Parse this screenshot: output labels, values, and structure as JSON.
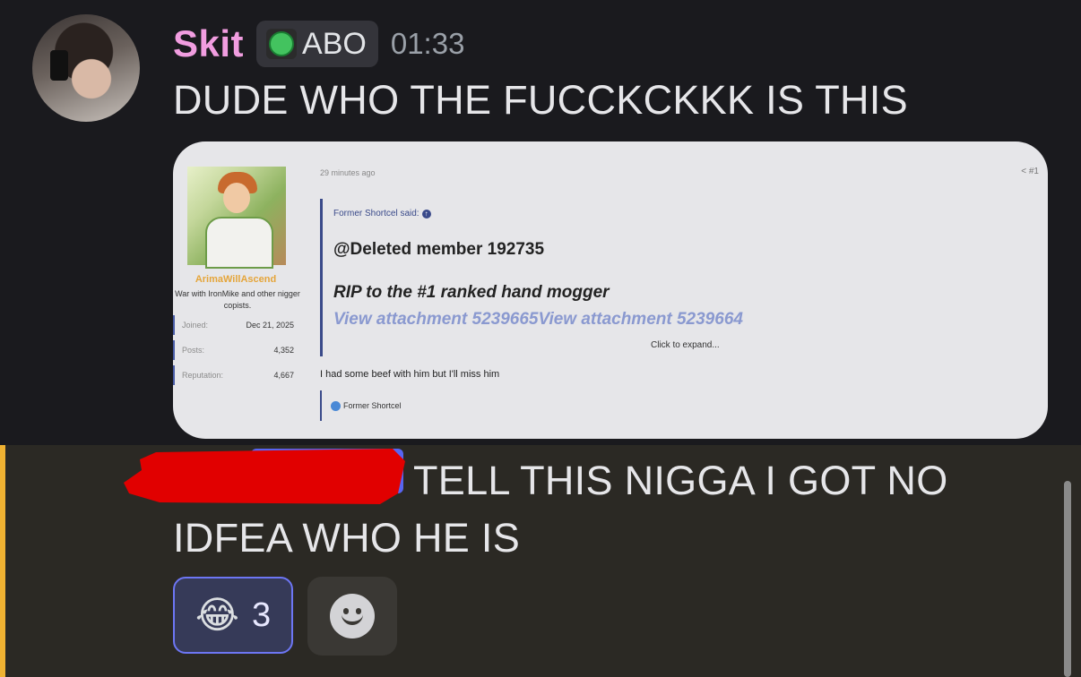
{
  "message1": {
    "username": "Skit",
    "tag": "ABO",
    "tag_icon": "game-pad-icon",
    "timestamp": "01:33",
    "text": "DUDE WHO THE FUCCKCKKK IS THIS"
  },
  "embed": {
    "time_ago": "29 minutes ago",
    "share": "< #1",
    "user": {
      "name": "ArimaWillAscend",
      "title": "War with IronMike and other nigger copists.",
      "stats": [
        {
          "label": "Joined:",
          "value": "Dec 21, 2025"
        },
        {
          "label": "Posts:",
          "value": "4,352"
        },
        {
          "label": "Reputation:",
          "value": "4,667"
        }
      ]
    },
    "quote": {
      "author_said": "Former Shortcel said:",
      "mention": "@Deleted member 192735",
      "line": "RIP to the #1 ranked hand mogger",
      "attachments": "View attachment 5239665View attachment 5239664",
      "expand": "Click to expand..."
    },
    "body": "I had some beef with him but I'll miss him",
    "signature": "Former Shortcel"
  },
  "message2": {
    "text": "TELL THIS NIGGA I GOT NO IDFEA WHO HE IS",
    "reaction_emoji": "😂",
    "reaction_count": "3"
  },
  "colors": {
    "username": "#f19de0",
    "highlight_accent": "#f0b232",
    "reaction_border": "#6d76f4",
    "redaction": "#e10000"
  }
}
